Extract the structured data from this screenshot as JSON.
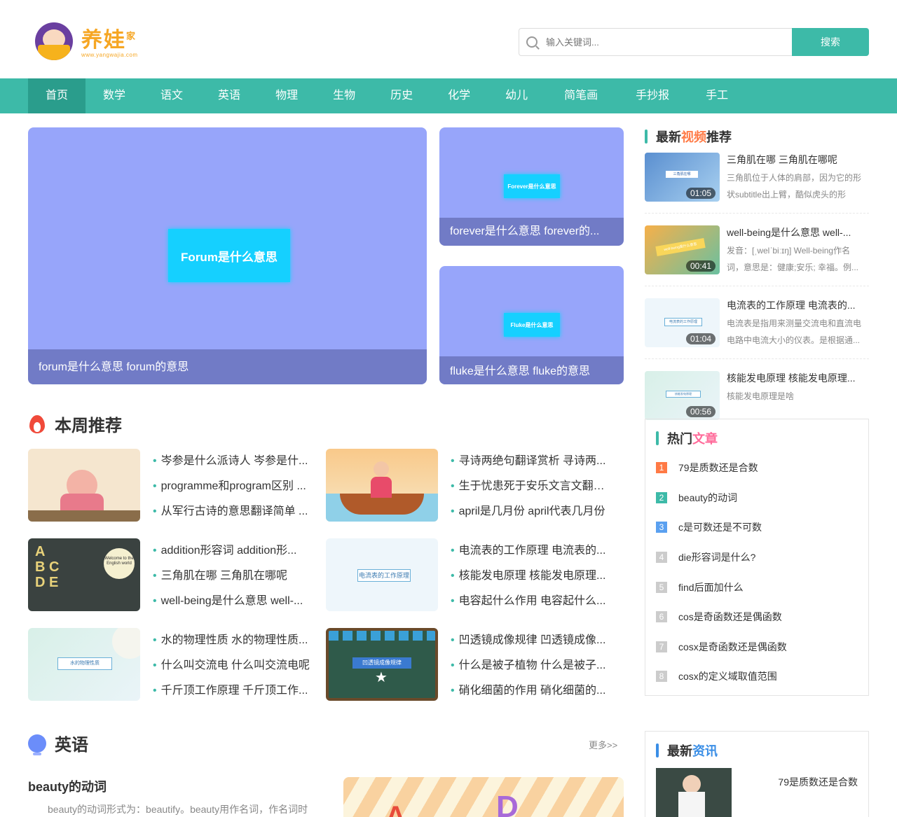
{
  "header": {
    "logo_text": "养娃",
    "logo_sup": "家",
    "logo_url": "www.yangwajia.com",
    "search_placeholder": "输入关键词...",
    "search_button": "搜索"
  },
  "nav": {
    "items": [
      "首页",
      "数学",
      "语文",
      "英语",
      "物理",
      "生物",
      "历史",
      "化学",
      "幼儿",
      "简笔画",
      "手抄报",
      "手工"
    ],
    "active": 0
  },
  "banners": {
    "big": {
      "tag": "Forum是什么意思",
      "caption": "forum是什么意思 forum的意思"
    },
    "small1": {
      "tag": "Forever是什么意思",
      "caption": "forever是什么意思 forever的..."
    },
    "small2": {
      "tag": "Fluke是什么意思",
      "caption": "fluke是什么意思 fluke的意思"
    }
  },
  "videos": {
    "title_a": "最新",
    "title_b": "视频",
    "title_c": "推荐",
    "items": [
      {
        "title": "三角肌在哪 三角肌在哪呢",
        "desc": "三角肌位于人体的肩部，因为它的形状subtitle出上臂，酷似虎头的形状。所...",
        "time": "01:05",
        "thumb_label": "三角肌在哪"
      },
      {
        "title": "well-being是什么意思 well-...",
        "desc": "发音：[ˌwelˈbiːɪŋ] Well-being作名词，意思是：健康;安乐; 幸福。例...",
        "time": "00:41",
        "thumb_label": "well-being是什么意思"
      },
      {
        "title": "电流表的工作原理 电流表的...",
        "desc": "电流表是指用来测量交流电和直流电电路中电流大小的仪表。是根据通...",
        "time": "01:04",
        "thumb_label": "电流表的工作原理"
      },
      {
        "title": "核能发电原理 核能发电原理...",
        "desc": "核能发电原理是啥",
        "time": "00:56",
        "thumb_label": "核能发电原理"
      }
    ]
  },
  "hot": {
    "title_a": "热门",
    "title_b": "文章",
    "items": [
      "79是质数还是合数",
      "beauty的动词",
      "c是可数还是不可数",
      "die形容词是什么?",
      "find后面加什么",
      "cos是奇函数还是偶函数",
      "cosx是奇函数还是偶函数",
      "cosx的定义域取值范围"
    ],
    "ranks": [
      "1",
      "2",
      "3",
      "4",
      "5",
      "6",
      "7",
      "8"
    ],
    "colors": [
      "#ff7a45",
      "#3dbaa8",
      "#5aa0f0",
      "#cccccc",
      "#cccccc",
      "#cccccc",
      "#cccccc",
      "#cccccc"
    ]
  },
  "news": {
    "title_a": "最新",
    "title_b": "资讯",
    "item": "79是质数还是合数"
  },
  "weekly": {
    "title": "本周推荐",
    "groups": [
      [
        "岑参是什么派诗人 岑参是什...",
        "programme和program区别 ...",
        "从军行古诗的意思翻译简单 ..."
      ],
      [
        "寻诗两绝句翻译赏析 寻诗两...",
        "生于忧患死于安乐文言文翻译...",
        "april是几月份 april代表几月份"
      ],
      [
        "addition形容词 addition形...",
        "三角肌在哪 三角肌在哪呢",
        "well-being是什么意思 well-..."
      ],
      [
        "电流表的工作原理 电流表的...",
        "核能发电原理 核能发电原理...",
        "电容起什么作用 电容起什么..."
      ],
      [
        "水的物理性质 水的物理性质...",
        "什么叫交流电 什么叫交流电呢",
        "千斤顶工作原理 千斤顶工作..."
      ],
      [
        "凹透镜成像规律 凹透镜成像...",
        "什么是被子植物 什么是被子...",
        "硝化细菌的作用 硝化细菌的..."
      ]
    ],
    "thumb_labels": [
      "",
      "",
      "Welcome to the English world",
      "电流表的工作原理",
      "水的物理性质",
      "凹透镜成像规律"
    ]
  },
  "english": {
    "title": "英语",
    "more": "更多>>",
    "headline": "beauty的动词",
    "summary": "beauty的动词形式为：beautify。beauty用作名词，作名词时"
  }
}
